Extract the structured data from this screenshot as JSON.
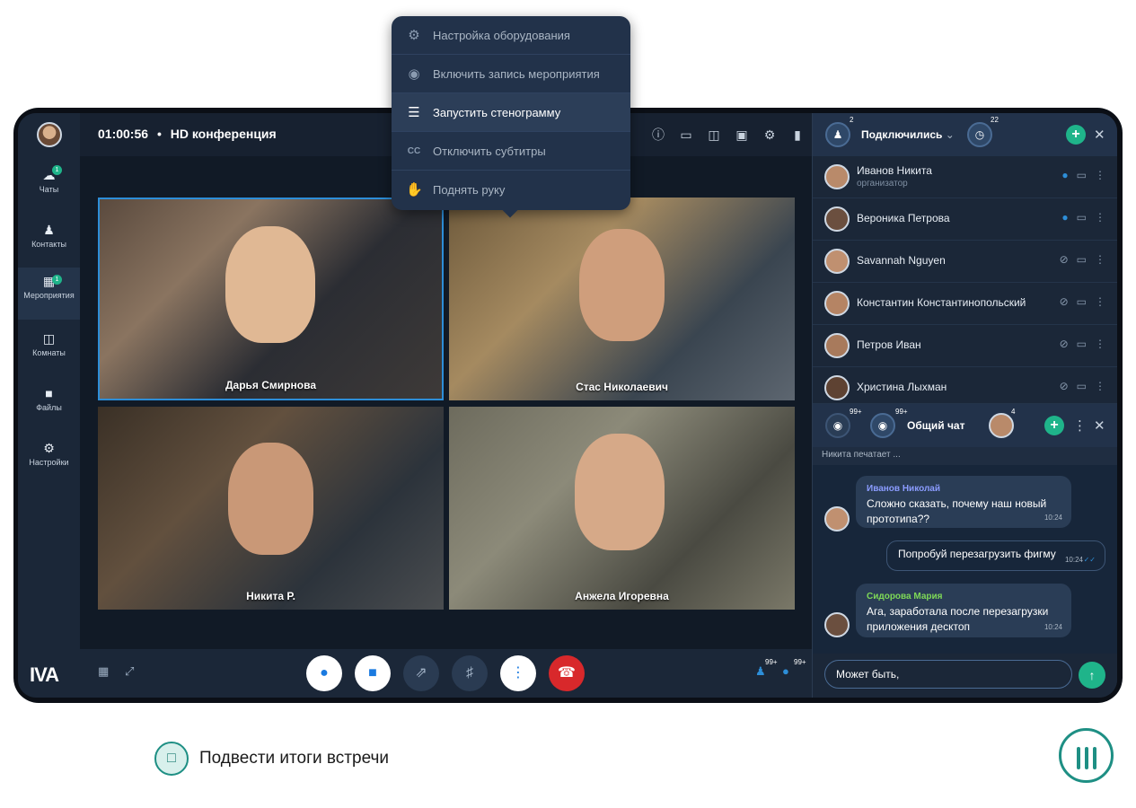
{
  "meeting": {
    "timer": "01:00:56",
    "separator": "•",
    "title": "HD конференция"
  },
  "sidebar": {
    "items": [
      {
        "label": "Чаты",
        "badge": "1",
        "icon": "chat-icon"
      },
      {
        "label": "Контакты",
        "icon": "contacts-icon"
      },
      {
        "label": "Мероприятия",
        "badge": "1",
        "icon": "calendar-icon"
      },
      {
        "label": "Комнаты",
        "icon": "rooms-icon"
      },
      {
        "label": "Файлы",
        "icon": "folder-icon"
      },
      {
        "label": "Настройки",
        "icon": "gear-icon"
      }
    ],
    "logo": "IVA"
  },
  "menu": {
    "items": [
      {
        "label": "Настройка оборудования",
        "icon": "gear-icon"
      },
      {
        "label": "Включить запись мероприятия",
        "icon": "record-icon"
      },
      {
        "label": "Запустить стенограмму",
        "icon": "transcript-icon"
      },
      {
        "label": "Отключить субтитры",
        "icon": "cc-icon"
      },
      {
        "label": "Поднять руку",
        "icon": "hand-icon"
      }
    ]
  },
  "participants_grid": [
    {
      "name": "Дарья Смирнова"
    },
    {
      "name": "Стас Николаевич"
    },
    {
      "name": "Никита Р."
    },
    {
      "name": "Анжела Игоревна"
    }
  ],
  "panel": {
    "header": {
      "connected_count": "2",
      "title": "Подключились",
      "waiting_count": "22"
    },
    "participants": [
      {
        "name": "Иванов Никита",
        "role": "организатор",
        "mic": "on"
      },
      {
        "name": "Вероника Петрова",
        "mic": "on"
      },
      {
        "name": "Savannah Nguyen",
        "mic": "off"
      },
      {
        "name": "Константин Константинопольский",
        "mic": "off"
      },
      {
        "name": "Петров Иван",
        "mic": "off"
      },
      {
        "name": "Христина Лыхман",
        "mic": "off"
      }
    ],
    "chat": {
      "viewers_count": "99+",
      "chats_count": "99+",
      "title": "Общий чат",
      "members_count": "4",
      "typing": "Никита печатает ...",
      "messages": [
        {
          "author": "Иванов Николай",
          "author_color": "#8b9cff",
          "text": "Сложно сказать, почему наш новый прототипа??",
          "time": "10:24"
        },
        {
          "text": "Попробуй перезагрузить фигму",
          "time": "10:24",
          "own": true
        },
        {
          "author": "Сидорова Мария",
          "author_color": "#7ed957",
          "text": "Ага, заработала после перезагрузки приложения десктоп",
          "time": "10:24"
        }
      ],
      "input_value": "Может быть,"
    }
  },
  "bottombar": {
    "participants_count": "99+",
    "chat_count": "99+"
  },
  "caption": {
    "text": "Подвести итоги встречи"
  },
  "colors": {
    "accent": "#1fb48a",
    "brand_teal": "#1e8f84",
    "end_call": "#d8282b",
    "mic_on": "#2d8ed8"
  }
}
